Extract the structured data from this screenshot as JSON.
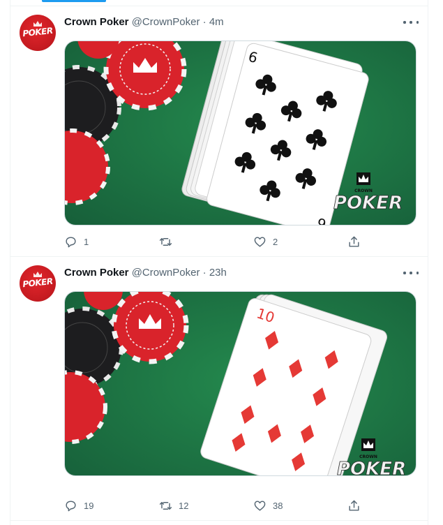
{
  "tweets": [
    {
      "author_name": "Crown Poker",
      "handle": "@CrownPoker",
      "separator": "·",
      "time": "4m",
      "avatar_text": "POKER",
      "media": {
        "card_rank": "9",
        "card_suit": "clubs",
        "card_color": "#111111",
        "logo_text": "POKER",
        "logo_brand": "CROWN"
      },
      "reply_count": "1",
      "retweet_count": "",
      "like_count": "2"
    },
    {
      "author_name": "Crown Poker",
      "handle": "@CrownPoker",
      "separator": "·",
      "time": "23h",
      "avatar_text": "POKER",
      "media": {
        "card_rank": "10",
        "card_suit": "diamonds",
        "card_color": "#e53935",
        "logo_text": "POKER",
        "logo_brand": "CROWN"
      },
      "reply_count": "19",
      "retweet_count": "12",
      "like_count": "38"
    }
  ],
  "icons": {
    "reply": "reply-icon",
    "retweet": "retweet-icon",
    "like": "heart-icon",
    "share": "share-icon",
    "more": "more-icon"
  },
  "colors": {
    "felt": "#1f7a44",
    "chip_red": "#d9232b",
    "chip_black": "#1d1d1f",
    "accent": "#1d9bf0",
    "secondary_text": "#536471"
  }
}
